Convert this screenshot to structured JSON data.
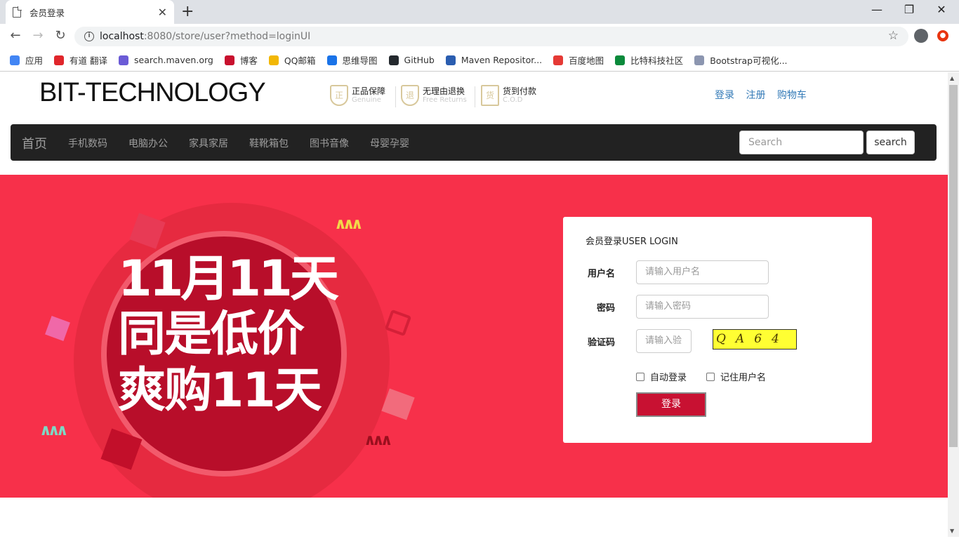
{
  "browser": {
    "tab_title": "会员登录",
    "tab_close": "✕",
    "new_tab": "+",
    "minimize": "—",
    "restore": "❐",
    "close": "✕",
    "url_host": "localhost",
    "url_rest": ":8080/store/user?method=loginUI",
    "bookmarks": [
      {
        "label": "应用",
        "color": "#4285f4"
      },
      {
        "label": "有道 翻译",
        "color": "#e0262b"
      },
      {
        "label": "search.maven.org",
        "color": "#6b5bd6"
      },
      {
        "label": "博客",
        "color": "#c8102e"
      },
      {
        "label": "QQ邮箱",
        "color": "#f2b705"
      },
      {
        "label": "思维导图",
        "color": "#1a73e8"
      },
      {
        "label": "GitHub",
        "color": "#24292e"
      },
      {
        "label": "Maven Repositor...",
        "color": "#2a5db0"
      },
      {
        "label": "百度地图",
        "color": "#e53935"
      },
      {
        "label": "比特科技社区",
        "color": "#0b8a3b"
      },
      {
        "label": "Bootstrap可视化...",
        "color": "#8c96b0"
      }
    ]
  },
  "header": {
    "logo": "BIT-TECHNOLOGY",
    "badges": [
      {
        "icon": "正",
        "title": "正品保障",
        "sub": "Genuine"
      },
      {
        "icon": "退",
        "title": "无理由退换",
        "sub": "Free Returns"
      },
      {
        "icon": "货",
        "title": "货到付款",
        "sub": "C.O.D"
      }
    ],
    "links": [
      "登录",
      "注册",
      "购物车"
    ]
  },
  "nav": {
    "brand": "首页",
    "items": [
      "手机数码",
      "电脑办公",
      "家具家居",
      "鞋靴箱包",
      "图书音像",
      "母婴孕婴"
    ],
    "search_placeholder": "Search",
    "search_button": "search"
  },
  "banner": {
    "line1": "11月11天",
    "line2": "同是低价",
    "line3": "爽购11天",
    "colors": {
      "bg": "#f7304a",
      "disc": "#b80e2a"
    }
  },
  "login": {
    "heading": "会员登录USER LOGIN",
    "username_label": "用户名",
    "username_placeholder": "请输入用户名",
    "password_label": "密码",
    "password_placeholder": "请输入密码",
    "captcha_label": "验证码",
    "captcha_placeholder": "请输入验",
    "captcha_text": "QA64",
    "auto_login": "自动登录",
    "remember_user": "记住用户名",
    "submit": "登录",
    "accent": "#c81132"
  }
}
